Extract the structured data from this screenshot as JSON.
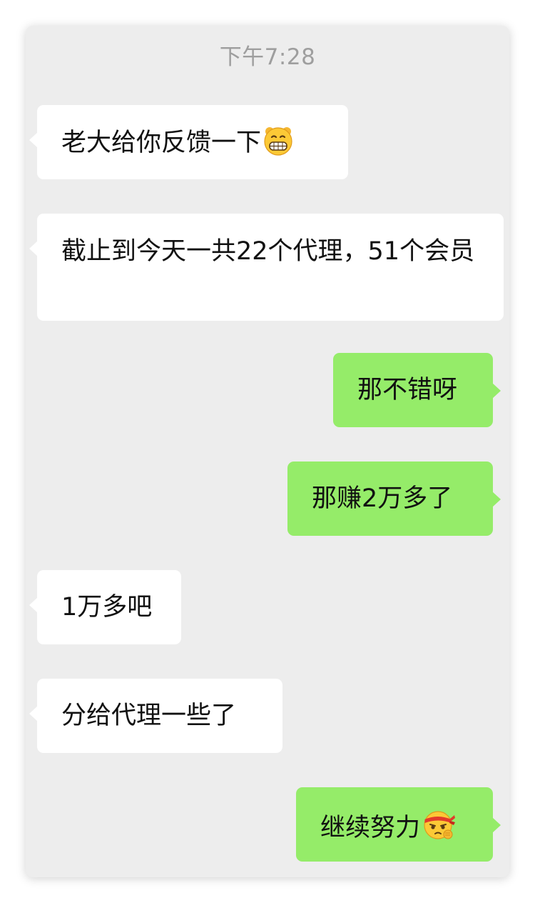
{
  "chat": {
    "timestamp": "下午7:28",
    "colors": {
      "background": "#ededed",
      "incoming_bubble": "#ffffff",
      "outgoing_bubble": "#95ec69",
      "timestamp_text": "#9e9e9e"
    },
    "messages": [
      {
        "direction": "incoming",
        "text": "老大给你反馈一下",
        "emoji": "grinning-face-icon"
      },
      {
        "direction": "incoming",
        "text": "截止到今天一共22个代理，51个会员"
      },
      {
        "direction": "outgoing",
        "text": "那不错呀"
      },
      {
        "direction": "outgoing",
        "text": "那赚2万多了"
      },
      {
        "direction": "incoming",
        "text": "1万多吧"
      },
      {
        "direction": "incoming",
        "text": "分给代理一些了"
      },
      {
        "direction": "outgoing",
        "text": "继续努力",
        "emoji": "determined-headband-face-icon"
      }
    ]
  }
}
